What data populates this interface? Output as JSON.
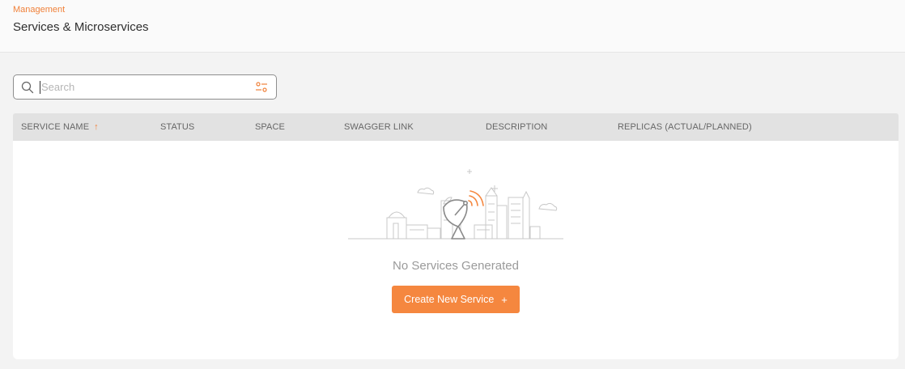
{
  "header": {
    "breadcrumb": "Management",
    "title": "Services & Microservices"
  },
  "search": {
    "placeholder": "Search",
    "value": "",
    "icon": "search-icon",
    "filter_icon": "filter-settings-icon"
  },
  "table": {
    "columns": [
      {
        "label": "SERVICE NAME",
        "sorted": "ascending"
      },
      {
        "label": "STATUS"
      },
      {
        "label": "SPACE"
      },
      {
        "label": "SWAGGER LINK"
      },
      {
        "label": "DESCRIPTION"
      },
      {
        "label": "REPLICAS (ACTUAL/PLANNED)"
      }
    ],
    "sort_icon": "arrow-up-icon",
    "rows": []
  },
  "empty_state": {
    "illustration": "satellite-dish-city-icon",
    "message": "No Services Generated",
    "button_label": "Create New Service",
    "button_icon": "plus-icon"
  },
  "colors": {
    "accent": "#f5873f",
    "breadcrumb": "#f0813a",
    "table_header_bg": "#e2e2e2",
    "page_bg": "#f3f3f3"
  }
}
